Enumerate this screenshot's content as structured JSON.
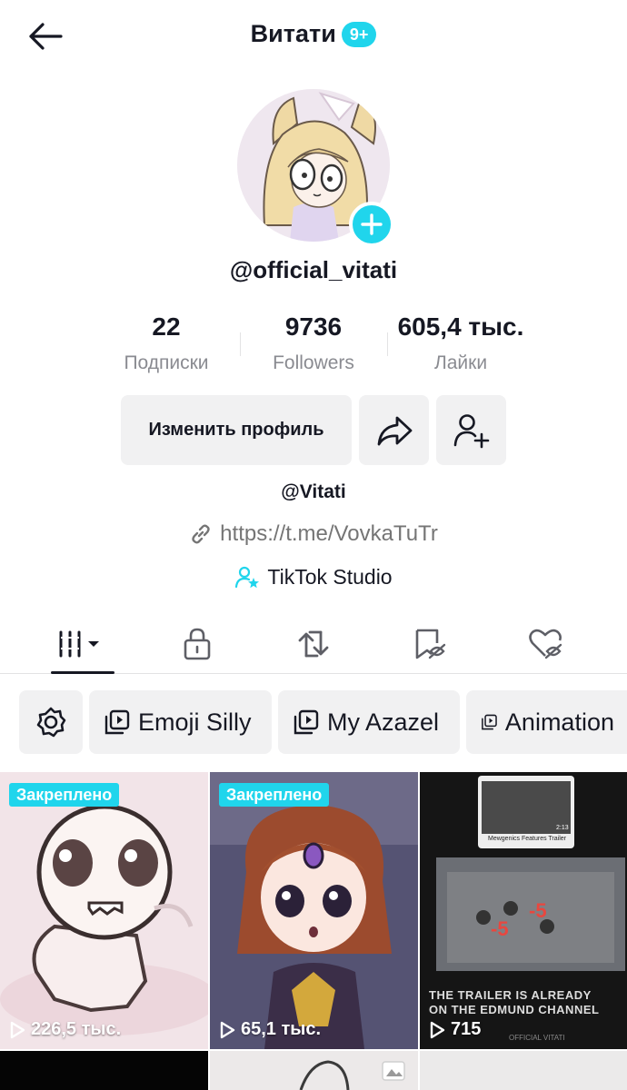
{
  "header": {
    "title": "Витати",
    "badge": "9+"
  },
  "profile": {
    "username": "@official_vitati"
  },
  "stats": [
    {
      "value": "22",
      "label": "Подписки"
    },
    {
      "value": "9736",
      "label": "Followers"
    },
    {
      "value": "605,4 тыс.",
      "label": "Лайки"
    }
  ],
  "actions": {
    "edit_profile": "Изменить профиль"
  },
  "bio": {
    "name": "@Vitati",
    "link": "https://t.me/VovkaTuTr",
    "studio": "TikTok Studio"
  },
  "tabs": [
    "videos-grid-icon",
    "lock-icon",
    "repost-icon",
    "saved-icon",
    "liked-icon"
  ],
  "collections": [
    "Emoji Silly",
    "My Azazel",
    "Animation"
  ],
  "videos": [
    {
      "pinned": "Закреплено",
      "views": "226,5 тыс."
    },
    {
      "pinned": "Закреплено",
      "views": "65,1 тыс."
    },
    {
      "views": "715",
      "thumb_title": "Mewgenics Features Trailer",
      "thumb_time": "2:13",
      "thumb_caption_1": "THE TRAILER IS ALREADY",
      "thumb_caption_2": "ON THE EDMUND CHANNEL",
      "thumb_watermark": "OFFICIAL VITATI"
    }
  ],
  "colors": {
    "accent": "#20d5ec",
    "text": "#161823",
    "muted": "#8a8b91",
    "chip_bg": "#f1f1f2"
  }
}
